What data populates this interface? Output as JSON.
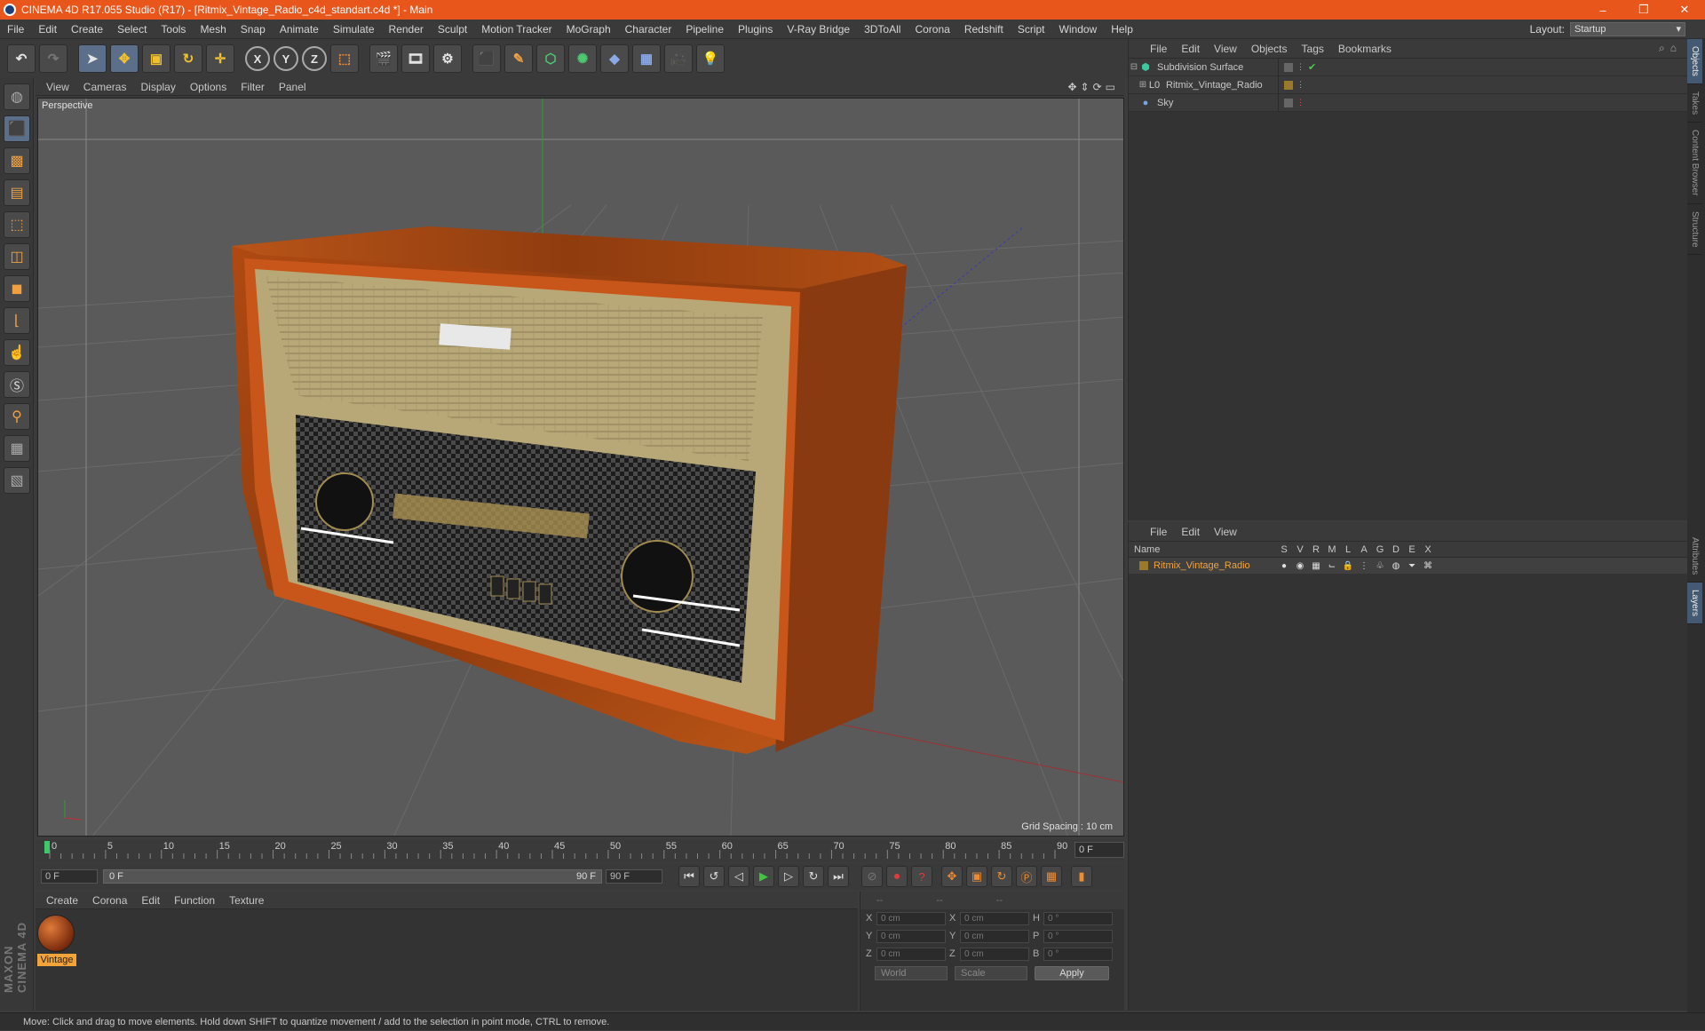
{
  "title": "CINEMA 4D R17.055 Studio (R17) - [Ritmix_Vintage_Radio_c4d_standart.c4d *] - Main",
  "window_controls": [
    "–",
    "❐",
    "✕"
  ],
  "menu": [
    "File",
    "Edit",
    "Create",
    "Select",
    "Tools",
    "Mesh",
    "Snap",
    "Animate",
    "Simulate",
    "Render",
    "Sculpt",
    "Motion Tracker",
    "MoGraph",
    "Character",
    "Pipeline",
    "Plugins",
    "V-Ray Bridge",
    "3DToAll",
    "Corona",
    "Redshift",
    "Script",
    "Window",
    "Help"
  ],
  "layout": {
    "label": "Layout:",
    "value": "Startup"
  },
  "toolbar_axes": [
    "X",
    "Y",
    "Z"
  ],
  "viewport": {
    "menu": [
      "View",
      "Cameras",
      "Display",
      "Options",
      "Filter",
      "Panel"
    ],
    "label": "Perspective",
    "grid_spacing": "Grid Spacing : 10 cm"
  },
  "timeline": {
    "ticks": [
      "0",
      "5",
      "10",
      "15",
      "20",
      "25",
      "30",
      "35",
      "40",
      "45",
      "50",
      "55",
      "60",
      "65",
      "70",
      "75",
      "80",
      "85",
      "90"
    ],
    "end_frame": "0 F"
  },
  "playback": {
    "start": "0 F",
    "range_start": "0 F",
    "range_end": "90 F",
    "end": "90 F"
  },
  "materials": {
    "menu": [
      "Create",
      "Corona",
      "Edit",
      "Function",
      "Texture"
    ],
    "items": [
      {
        "name": "Vintage"
      }
    ]
  },
  "coordinates": {
    "headers": [
      "--",
      "--",
      "--"
    ],
    "rows": [
      {
        "a1": "X",
        "v1": "0 cm",
        "a2": "X",
        "v2": "0 cm",
        "a3": "H",
        "v3": "0 °"
      },
      {
        "a1": "Y",
        "v1": "0 cm",
        "a2": "Y",
        "v2": "0 cm",
        "a3": "P",
        "v3": "0 °"
      },
      {
        "a1": "Z",
        "v1": "0 cm",
        "a2": "Z",
        "v2": "0 cm",
        "a3": "B",
        "v3": "0 °"
      }
    ],
    "world": "World",
    "scale": "Scale",
    "apply": "Apply"
  },
  "objects": {
    "menu": [
      "File",
      "Edit",
      "View",
      "Objects",
      "Tags",
      "Bookmarks"
    ],
    "items": [
      {
        "name": "Subdivision Surface",
        "icon_color": "#3ec8a0"
      },
      {
        "name": "Ritmix_Vintage_Radio",
        "icon_color": "#c8c8c8"
      },
      {
        "name": "Sky",
        "icon_color": "#7aa6e0"
      }
    ]
  },
  "layers": {
    "menu": [
      "File",
      "Edit",
      "View"
    ],
    "headers": {
      "name": "Name",
      "cols": [
        "S",
        "V",
        "R",
        "M",
        "L",
        "A",
        "G",
        "D",
        "E",
        "X"
      ]
    },
    "items": [
      {
        "name": "Ritmix_Vintage_Radio"
      }
    ]
  },
  "side_tabs": [
    "Objects",
    "Takes",
    "Content Browser",
    "Structure",
    "Attributes",
    "Layers"
  ],
  "maxon_logo": "MAXON CINEMA 4D",
  "status": "Move: Click and drag to move elements. Hold down SHIFT to quantize movement / add to the selection in point mode, CTRL to remove.",
  "colors": {
    "titlebar": "#e8561c",
    "accent": "#f2a33a",
    "viewport_bg": "#5a5a5a"
  }
}
